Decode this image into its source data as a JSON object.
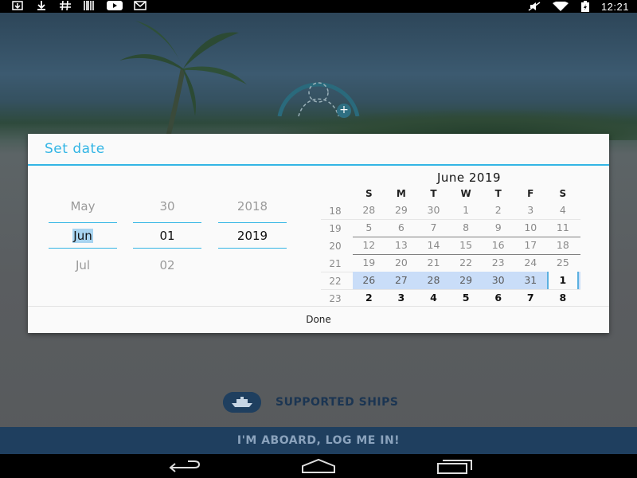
{
  "status_bar": {
    "left_icons": [
      "download-box-icon",
      "download-icon",
      "hash-icon",
      "barcode-icon",
      "youtube-icon",
      "gmail-icon"
    ],
    "right_icons": [
      "mute-icon",
      "wifi-icon",
      "battery-charging-icon"
    ],
    "time": "12:21"
  },
  "dialog": {
    "title": "Set date",
    "month": {
      "prev": "May",
      "current": "Jun",
      "next": "Jul"
    },
    "day": {
      "prev": "30",
      "current": "01",
      "next": "02"
    },
    "year": {
      "prev": "2018",
      "current": "2019"
    },
    "calendar": {
      "title": "June 2019",
      "weekdays": [
        "S",
        "M",
        "T",
        "W",
        "T",
        "F",
        "S"
      ],
      "weeks": [
        {
          "num": "18",
          "days": [
            "28",
            "29",
            "30",
            "1",
            "2",
            "3",
            "4"
          ]
        },
        {
          "num": "19",
          "days": [
            "5",
            "6",
            "7",
            "8",
            "9",
            "10",
            "11"
          ]
        },
        {
          "num": "20",
          "days": [
            "12",
            "13",
            "14",
            "15",
            "16",
            "17",
            "18"
          ]
        },
        {
          "num": "21",
          "days": [
            "19",
            "20",
            "21",
            "22",
            "23",
            "24",
            "25"
          ]
        },
        {
          "num": "22",
          "days": [
            "26",
            "27",
            "28",
            "29",
            "30",
            "31",
            "1"
          ]
        },
        {
          "num": "23",
          "days": [
            "2",
            "3",
            "4",
            "5",
            "6",
            "7",
            "8"
          ]
        }
      ],
      "selected_day": "1"
    },
    "done_label": "Done"
  },
  "app": {
    "supported_ships_label": "SUPPORTED SHIPS",
    "aboard_button_label": "I'M ABOARD, LOG ME IN!"
  },
  "colors": {
    "accent": "#33b5e5",
    "selected_week": "#c9ddf8",
    "brand_navy": "#1f3f5f"
  },
  "nav_bar": [
    "back-icon",
    "home-icon",
    "recents-icon"
  ]
}
